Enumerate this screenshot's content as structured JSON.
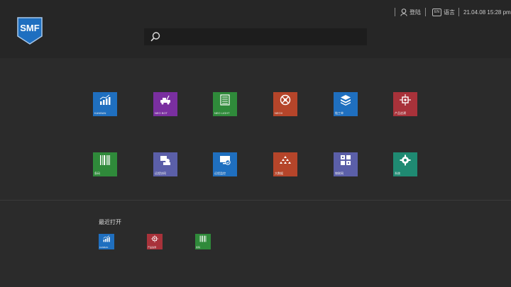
{
  "header": {
    "logo_text": "SMF",
    "search": {
      "placeholder": "",
      "value": ""
    },
    "login_label": "登陆",
    "lang_badge": "EN",
    "lang_label": "语言",
    "datetime": "21.04.08 15:28 pm"
  },
  "apps": [
    {
      "label": "KANBAN",
      "color": "#1f6fbf",
      "icon": "chart-icon"
    },
    {
      "label": "NEO BOT",
      "color": "#7a2fa0",
      "icon": "bot-icon"
    },
    {
      "label": "NEO LIGHT",
      "color": "#2f8a3a",
      "icon": "light-icon"
    },
    {
      "label": "NEOX",
      "color": "#b5452a",
      "icon": "neox-icon"
    },
    {
      "label": "链工单",
      "color": "#1f6fbf",
      "icon": "workorder-icon"
    },
    {
      "label": "产品追溯",
      "color": "#a8323a",
      "icon": "trace-icon"
    },
    {
      "label": "条码",
      "color": "#2f8a3a",
      "icon": "barcode-icon"
    },
    {
      "label": "远程协同",
      "color": "#5b5fa8",
      "icon": "collab-icon"
    },
    {
      "label": "远程监控",
      "color": "#1f6fbf",
      "icon": "monitor-icon"
    },
    {
      "label": "大数据",
      "color": "#b5452a",
      "icon": "bigdata-icon"
    },
    {
      "label": "物联网",
      "color": "#5b5fa8",
      "icon": "iot-icon"
    },
    {
      "label": "系统",
      "color": "#1f8a72",
      "icon": "settings-icon"
    }
  ],
  "recent": {
    "title": "最近打开",
    "items": [
      {
        "label": "KANBAN",
        "color": "#1f6fbf",
        "icon": "chart-icon"
      },
      {
        "label": "产品追溯",
        "color": "#a8323a",
        "icon": "trace-icon"
      },
      {
        "label": "条码",
        "color": "#2f8a3a",
        "icon": "barcode-icon"
      }
    ]
  }
}
